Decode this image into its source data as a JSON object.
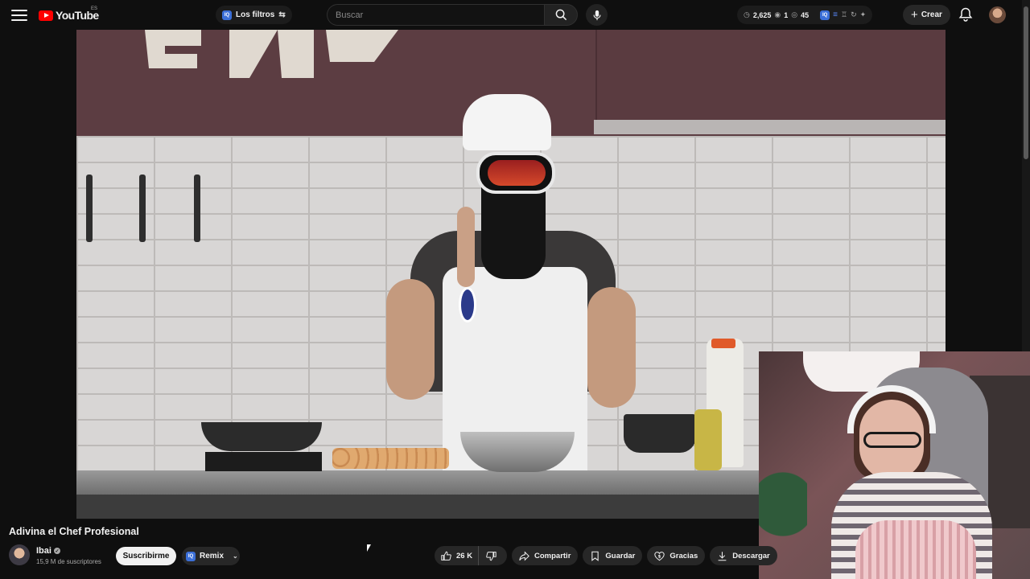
{
  "header": {
    "logo_text": "YouTube",
    "region": "ES",
    "filters_label": "Los filtros",
    "filters_badge": "IQ",
    "search_placeholder": "Buscar",
    "stats": {
      "hours": "2,625",
      "views_a": "1",
      "views_b": "45",
      "badge": "IQ"
    },
    "create_label": "Crear"
  },
  "video": {
    "title": "Adivina el Chef Profesional",
    "channel": "Ibai",
    "subscribers": "15,9 M de suscriptores",
    "subscribe_label": "Suscribirme",
    "remix_label": "Remix",
    "remix_badge": "IQ"
  },
  "actions": {
    "likes": "26 K",
    "share": "Compartir",
    "save": "Guardar",
    "thanks": "Gracias",
    "download": "Descargar"
  },
  "colors": {
    "brand_red": "#ff0000",
    "background": "#0f0f0f",
    "pill": "#272727",
    "accent_blue": "#3b6fd8"
  }
}
